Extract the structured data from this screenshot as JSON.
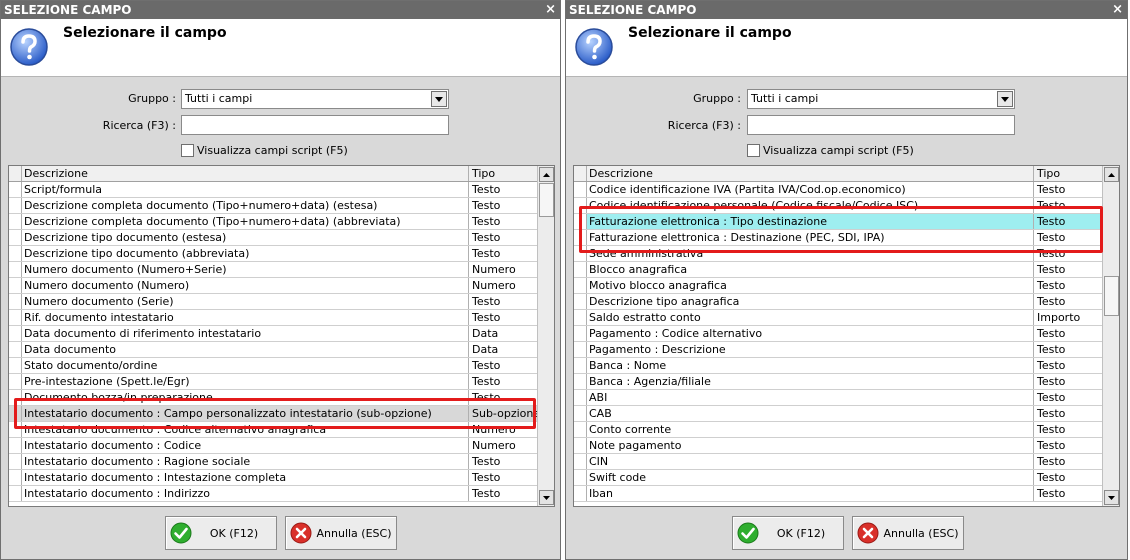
{
  "left": {
    "title": "SELEZIONE CAMPO",
    "heading": "Selezionare il campo",
    "group_label": "Gruppo :",
    "group_value": "Tutti i campi",
    "search_label": "Ricerca (F3) :",
    "search_value": "",
    "script_checkbox": "Visualizza campi script (F5)",
    "col_desc": "Descrizione",
    "col_type": "Tipo",
    "rows": [
      {
        "desc": "Script/formula",
        "type": "Testo"
      },
      {
        "desc": "Descrizione completa documento (Tipo+numero+data) (estesa)",
        "type": "Testo"
      },
      {
        "desc": "Descrizione completa documento (Tipo+numero+data) (abbreviata)",
        "type": "Testo"
      },
      {
        "desc": "Descrizione tipo documento (estesa)",
        "type": "Testo"
      },
      {
        "desc": "Descrizione tipo documento (abbreviata)",
        "type": "Testo"
      },
      {
        "desc": "Numero documento (Numero+Serie)",
        "type": "Numero"
      },
      {
        "desc": "Numero documento (Numero)",
        "type": "Numero"
      },
      {
        "desc": "Numero documento (Serie)",
        "type": "Testo"
      },
      {
        "desc": "Rif. documento intestatario",
        "type": "Testo"
      },
      {
        "desc": "Data documento di riferimento intestatario",
        "type": "Data"
      },
      {
        "desc": "Data documento",
        "type": "Data"
      },
      {
        "desc": "Stato documento/ordine",
        "type": "Testo"
      },
      {
        "desc": "Pre-intestazione (Spett.le/Egr)",
        "type": "Testo"
      },
      {
        "desc": "Documento bozza/in preparazione",
        "type": "Testo"
      },
      {
        "desc": "Intestatario documento : Campo personalizzato intestatario (sub-opzione)",
        "type": "Sub-opzione"
      },
      {
        "desc": "Intestatario documento : Codice alternativo anagrafica",
        "type": "Numero"
      },
      {
        "desc": "Intestatario documento : Codice",
        "type": "Numero"
      },
      {
        "desc": "Intestatario documento : Ragione sociale",
        "type": "Testo"
      },
      {
        "desc": "Intestatario documento : Intestazione completa",
        "type": "Testo"
      },
      {
        "desc": "Intestatario documento : Indirizzo",
        "type": "Testo"
      }
    ],
    "ok_label": "OK (F12)",
    "cancel_label": "Annulla (ESC)"
  },
  "right": {
    "title": "SELEZIONE CAMPO",
    "heading": "Selezionare il campo",
    "group_label": "Gruppo :",
    "group_value": "Tutti i campi",
    "search_label": "Ricerca (F3) :",
    "search_value": "",
    "script_checkbox": "Visualizza campi script (F5)",
    "col_desc": "Descrizione",
    "col_type": "Tipo",
    "rows": [
      {
        "desc": "Codice identificazione IVA (Partita IVA/Cod.op.economico)",
        "type": "Testo"
      },
      {
        "desc": "Codice identificazione personale (Codice fiscale/Codice ISC)",
        "type": "Testo"
      },
      {
        "desc": "Fatturazione elettronica : Tipo destinazione",
        "type": "Testo"
      },
      {
        "desc": "Fatturazione elettronica : Destinazione (PEC, SDI, IPA)",
        "type": "Testo"
      },
      {
        "desc": "Sede amministrativa",
        "type": "Testo"
      },
      {
        "desc": "Blocco anagrafica",
        "type": "Testo"
      },
      {
        "desc": "Motivo blocco anagrafica",
        "type": "Testo"
      },
      {
        "desc": "Descrizione tipo anagrafica",
        "type": "Testo"
      },
      {
        "desc": "Saldo estratto conto",
        "type": "Importo"
      },
      {
        "desc": "Pagamento : Codice alternativo",
        "type": "Testo"
      },
      {
        "desc": "Pagamento : Descrizione",
        "type": "Testo"
      },
      {
        "desc": "Banca : Nome",
        "type": "Testo"
      },
      {
        "desc": "Banca : Agenzia/filiale",
        "type": "Testo"
      },
      {
        "desc": "ABI",
        "type": "Testo"
      },
      {
        "desc": "CAB",
        "type": "Testo"
      },
      {
        "desc": "Conto corrente",
        "type": "Testo"
      },
      {
        "desc": "Note pagamento",
        "type": "Testo"
      },
      {
        "desc": "CIN",
        "type": "Testo"
      },
      {
        "desc": "Swift code",
        "type": "Testo"
      },
      {
        "desc": "Iban",
        "type": "Testo"
      }
    ],
    "ok_label": "OK (F12)",
    "cancel_label": "Annulla (ESC)"
  },
  "close_glyph": "×",
  "colors": {
    "titlebar": "#6a6a6a",
    "highlight_box": "#e31b1b",
    "selected_cyan": "#9eeef0",
    "ok_icon": "#2fae2f",
    "cancel_icon": "#d9302a"
  }
}
